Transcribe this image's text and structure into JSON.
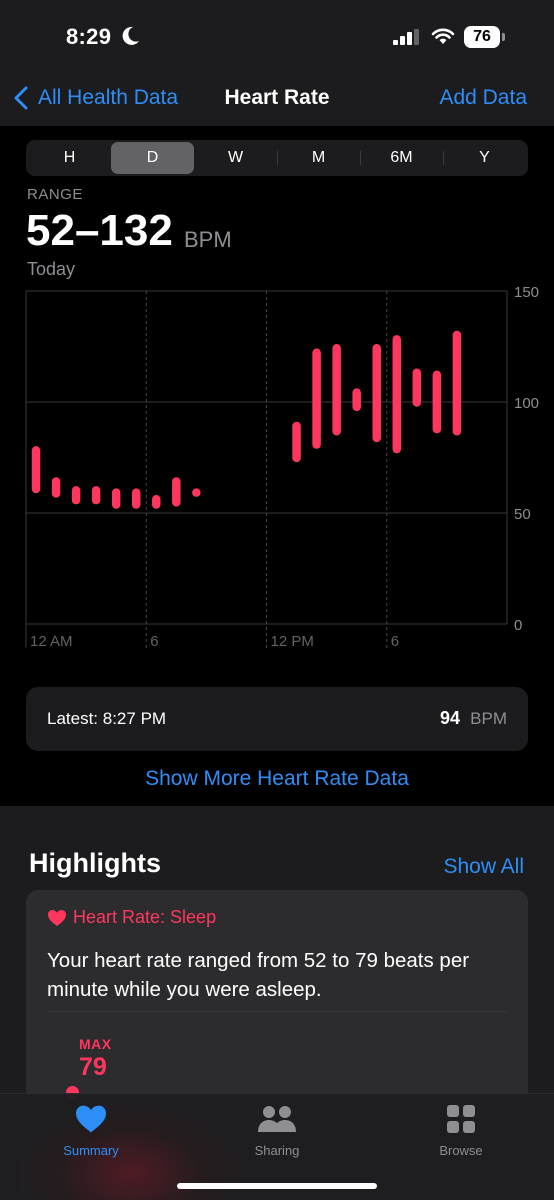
{
  "status_bar": {
    "time": "8:29",
    "focus_icon": "moon-icon",
    "battery": "76"
  },
  "nav": {
    "back_label": "All Health Data",
    "title": "Heart Rate",
    "action_label": "Add Data"
  },
  "segments": [
    {
      "label": "H",
      "selected": false
    },
    {
      "label": "D",
      "selected": true
    },
    {
      "label": "W",
      "selected": false
    },
    {
      "label": "M",
      "selected": false
    },
    {
      "label": "6M",
      "selected": false
    },
    {
      "label": "Y",
      "selected": false
    }
  ],
  "summary": {
    "label": "RANGE",
    "value": "52–132",
    "unit": "BPM",
    "date": "Today"
  },
  "chart_data": {
    "type": "bar",
    "subtype": "range",
    "x_unit": "hour of day",
    "ylim": [
      0,
      150
    ],
    "y_ticks": [
      "0",
      "50",
      "100",
      "150"
    ],
    "x_tick_labels": [
      "12 AM",
      "6",
      "12 PM",
      "6"
    ],
    "grid": true,
    "color": "#ff375f",
    "series": [
      {
        "x": [
          0.5,
          1.5,
          2.5,
          3.5,
          4.5,
          5.5,
          6.5,
          7.5,
          8.5,
          13.5,
          14.5,
          15.5,
          16.5,
          17.5,
          18.5,
          19.5,
          20.5,
          21.5
        ],
        "low": [
          59,
          57,
          54,
          54,
          52,
          52,
          52,
          53,
          58,
          73,
          79,
          85,
          96,
          82,
          77,
          98,
          86,
          85
        ],
        "high": [
          80,
          66,
          62,
          62,
          61,
          61,
          58,
          66,
          61,
          91,
          124,
          126,
          106,
          126,
          130,
          115,
          114,
          132
        ]
      }
    ]
  },
  "latest": {
    "label": "Latest: 8:27 PM",
    "value": "94",
    "unit": "BPM"
  },
  "show_more": "Show More Heart Rate Data",
  "highlights": {
    "title": "Highlights",
    "show_all": "Show All",
    "card": {
      "heading": "Heart Rate: Sleep",
      "body": "Your heart rate ranged from 52 to 79 beats per minute while you were asleep.",
      "max_label": "MAX",
      "max_value": "79"
    }
  },
  "tabs": [
    {
      "label": "Summary",
      "icon": "heart-icon",
      "active": true
    },
    {
      "label": "Sharing",
      "icon": "people-icon",
      "active": false
    },
    {
      "label": "Browse",
      "icon": "grid-icon",
      "active": false
    }
  ],
  "colors": {
    "accent_blue": "#2e8ef7",
    "heart_red": "#ff375f",
    "background": "#000000",
    "card": "#1c1c1e"
  }
}
